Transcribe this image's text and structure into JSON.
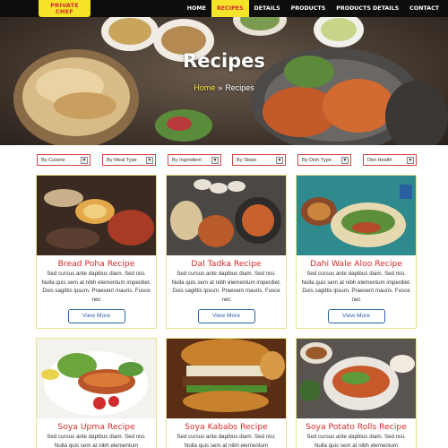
{
  "brand": {
    "logo_line1": "PRIVATE",
    "logo_line2": "CHEF"
  },
  "nav": {
    "items": [
      "HOME",
      "RECIPES",
      "DETAILS",
      "PRODUCTS",
      "PRODUCTS DETAILS",
      "CONTACT"
    ],
    "active": "RECIPES"
  },
  "hero": {
    "title": "Recipes",
    "crumb_home": "Home",
    "crumb_sep": "»",
    "crumb_current": "Recipes"
  },
  "filters": [
    "By Cuisine",
    "By Meal Type",
    "By Ingredient",
    "By Steps",
    "By Dish Type",
    "Diet Health"
  ],
  "card_text": "Sed cursus ante dapibus diam. Sed nisi. Nulla quis sem at nibh elementum imperdiet. Duis sagittis ipsum. Praesent mauris. Fusce nec",
  "card_text_partial": "Sed cursus ante dapibus diam. Sed nisi. Nulla quis sem at nibh elementum",
  "button_label": "View More",
  "cards": [
    {
      "title": "Bread Poha Recipe"
    },
    {
      "title": "Dal Tadka Recipe"
    },
    {
      "title": "Dahi Wale Aloo Recipe"
    },
    {
      "title": "Soya Upma Recipe"
    },
    {
      "title": "Soya Kababs Recipe"
    },
    {
      "title": "Soya Potato Rolls Recipe"
    }
  ],
  "colors": {
    "accent_yellow": "#f5e32a",
    "accent_red": "#d52b2b",
    "button_blue": "#2e63a5",
    "nav_bg": "#0d0d0d"
  }
}
